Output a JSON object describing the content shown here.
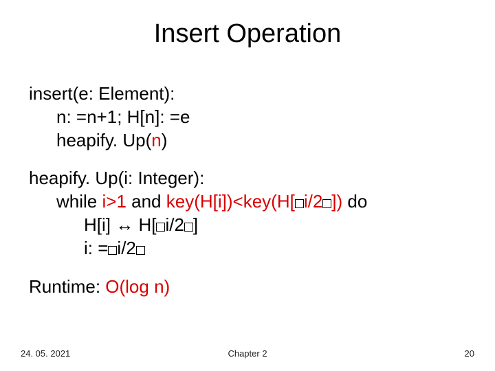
{
  "title": "Insert Operation",
  "insert": {
    "sig": "insert(e: Element):",
    "line1a": "n: =n+1; H[n]: =e",
    "line2_pre": "heapify. Up(",
    "line2_arg": "n",
    "line2_post": ")"
  },
  "heapify": {
    "sig": "heapify. Up(i: Integer):",
    "while_pre": "while ",
    "while_cond_black": "i>1",
    "while_and": " and ",
    "while_cond_red_a": "key(H[i])<key(H[",
    "while_cond_red_b": "i/2",
    "while_cond_red_c": "])",
    "while_do": " do",
    "swap_a": "H[i] ↔ H[",
    "swap_b": "i/2",
    "swap_c": "]",
    "assign_a": "i: =",
    "assign_b": "i/2"
  },
  "runtime_label": "Runtime: ",
  "runtime_value": "O(log n)",
  "footer": {
    "date": "24. 05. 2021",
    "chapter": "Chapter 2",
    "page": "20"
  }
}
